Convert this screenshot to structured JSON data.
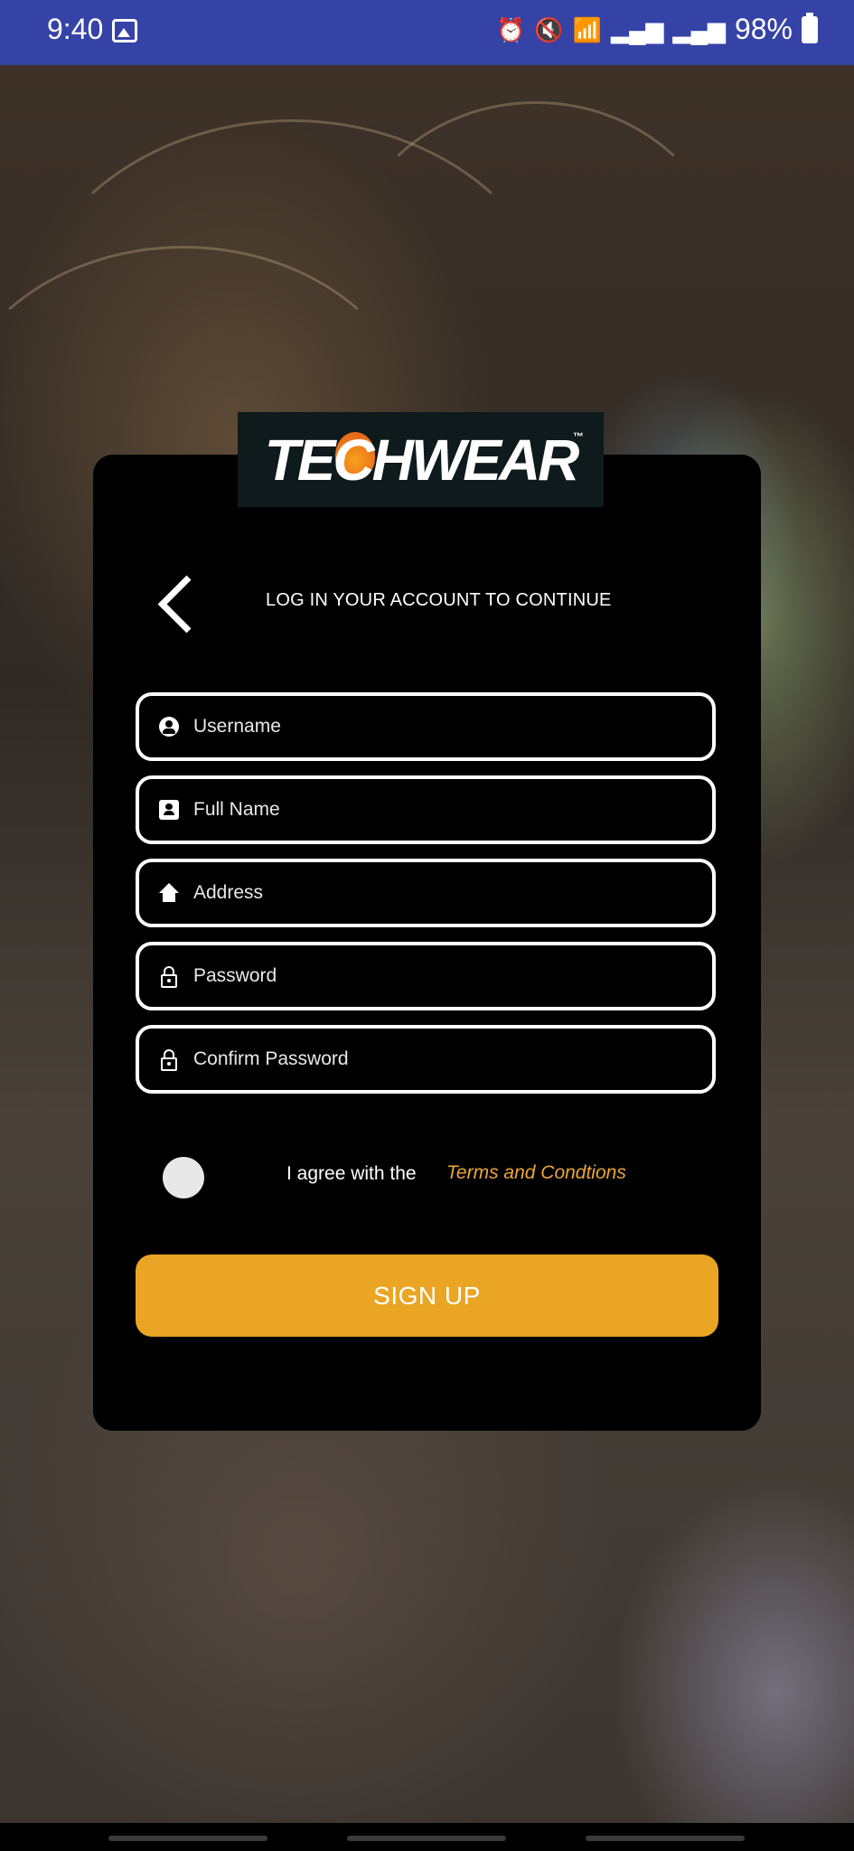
{
  "status_bar": {
    "time": "9:40",
    "battery": "98%",
    "icons": [
      "image-icon",
      "alarm-icon",
      "mute-icon",
      "wifi-icon",
      "signal-icon",
      "signal-icon",
      "battery-icon"
    ]
  },
  "logo": {
    "text": "TECHWEAR",
    "tm": "™"
  },
  "header": {
    "title": "LOG IN YOUR ACCOUNT TO CONTINUE"
  },
  "form": {
    "username": {
      "placeholder": "Username",
      "icon": "account-circle-icon"
    },
    "full_name": {
      "placeholder": "Full Name",
      "icon": "contact-card-icon"
    },
    "address": {
      "placeholder": "Address",
      "icon": "home-icon"
    },
    "password": {
      "placeholder": "Password",
      "icon": "lock-icon"
    },
    "confirm_password": {
      "placeholder": "Confirm Password",
      "icon": "lock-icon"
    }
  },
  "terms": {
    "agree_label": "I agree with the",
    "link_label": "Terms and Condtions",
    "accepted": false
  },
  "signup_button": {
    "label": "SIGN UP"
  },
  "colors": {
    "status_bar": "#3643a6",
    "accent": "#eaa525",
    "link": "#eda638",
    "card": "#000000"
  }
}
